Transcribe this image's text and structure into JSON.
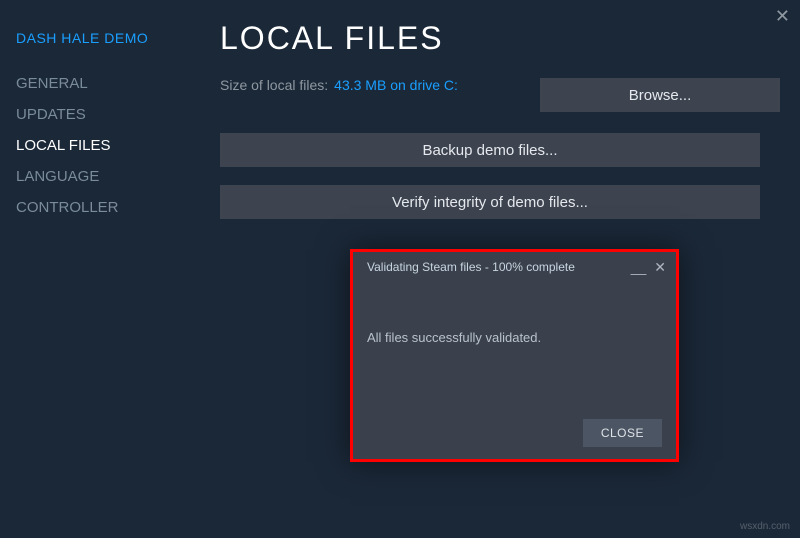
{
  "window": {
    "close": "✕"
  },
  "sidebar": {
    "game_title": "DASH HALE DEMO",
    "items": [
      {
        "label": "GENERAL"
      },
      {
        "label": "UPDATES"
      },
      {
        "label": "LOCAL FILES"
      },
      {
        "label": "LANGUAGE"
      },
      {
        "label": "CONTROLLER"
      }
    ],
    "active_index": 2
  },
  "main": {
    "title": "LOCAL FILES",
    "size_label": "Size of local files:",
    "size_value": "43.3 MB on drive C:",
    "browse_label": "Browse...",
    "backup_label": "Backup demo files...",
    "verify_label": "Verify integrity of demo files..."
  },
  "dialog": {
    "title": "Validating Steam files - 100% complete",
    "minimize": "__",
    "close": "✕",
    "message": "All files successfully validated.",
    "close_button": "CLOSE"
  },
  "watermark": "wsxdn.com"
}
